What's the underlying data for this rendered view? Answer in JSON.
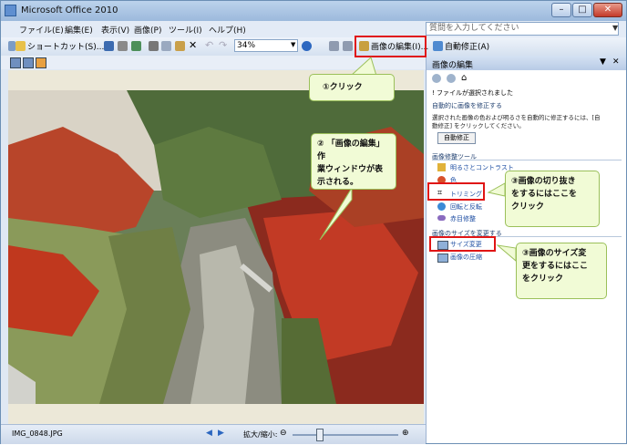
{
  "window": {
    "title": "Microsoft Office 2010"
  },
  "menu": [
    "ファイル(E)",
    "編集(E)",
    "表示(V)",
    "画像(P)",
    "ツール(I)",
    "ヘルプ(H)"
  ],
  "ask_placeholder": "質問を入力してください",
  "toolbar": {
    "shortcut_label": "ショートカット(S)...",
    "zoom_value": "34%",
    "edit_image_label": "画像の編集(I)...",
    "auto_correct_label": "自動修正(A)"
  },
  "status": {
    "filename": "IMG_0848.JPG",
    "zoom_label": "拡大/縮小:"
  },
  "pane": {
    "title": "画像の編集",
    "no_file_text": "! ファイルが選択されました",
    "auto_section": "自動的に画像を修正する",
    "auto_desc_line1": "選択された画像の色および明るさを自動的に修正するには、[自",
    "auto_desc_line2": "動修正] をクリックしてください。",
    "auto_button": "自動修正",
    "tools_section": "画像修整ツール",
    "tools": [
      "明るさとコントラスト",
      "色",
      "トリミング",
      "回転と反転",
      "赤目修整"
    ],
    "size_section": "画像のサイズを変更する",
    "size_items": [
      "サイズ変更",
      "画像の圧縮"
    ]
  },
  "callouts": {
    "c1": "①クリック",
    "c2_l1": "② 「画像の編集」 作",
    "c2_l2": "業ウィンドウが表",
    "c2_l3": "示される。",
    "c3_l1": "③画像の切り抜き",
    "c3_l2": "をするにはここを",
    "c3_l3": "クリック",
    "c4_l1": "③画像のサイズ変",
    "c4_l2": "更をするにはここ",
    "c4_l3": "をクリック"
  }
}
